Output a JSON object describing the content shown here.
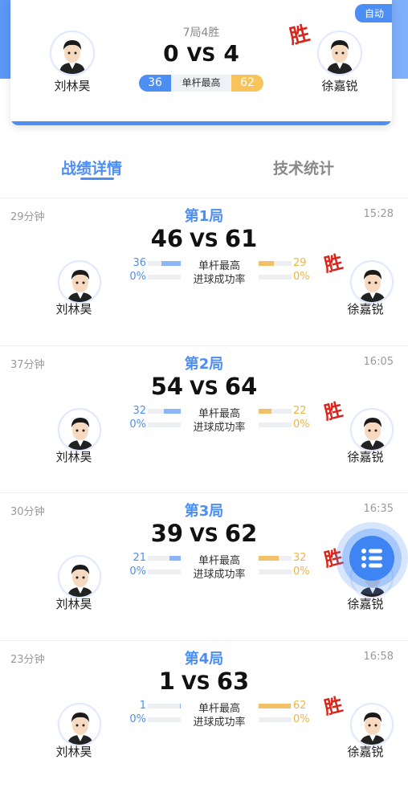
{
  "header": {
    "auto_label": "自动",
    "match_count": "7局4胜",
    "left_player": "刘林昊",
    "right_player": "徐嘉锐",
    "left_score": "0",
    "right_score": "4",
    "vs": "VS",
    "win_mark": "胜",
    "left_high_break": "36",
    "right_high_break": "62",
    "high_break_label": "单杆最高"
  },
  "tabs": {
    "active": "战绩详情",
    "inactive": "技术统计"
  },
  "labels": {
    "high_break": "单杆最高",
    "pot_rate": "进球成功率",
    "vs": "VS",
    "win": "胜"
  },
  "games": [
    {
      "duration": "29分钟",
      "time": "15:28",
      "title": "第1局",
      "left_score": "46",
      "right_score": "61",
      "left_break": "36",
      "right_break": "29",
      "left_rate": "0%",
      "right_rate": "0%",
      "left_player": "刘林昊",
      "right_player": "徐嘉锐",
      "left_break_fill": 0.58,
      "right_break_fill": 0.47,
      "winner": "right"
    },
    {
      "duration": "37分钟",
      "time": "16:05",
      "title": "第2局",
      "left_score": "54",
      "right_score": "64",
      "left_break": "32",
      "right_break": "22",
      "left_rate": "0%",
      "right_rate": "0%",
      "left_player": "刘林昊",
      "right_player": "徐嘉锐",
      "left_break_fill": 0.52,
      "right_break_fill": 0.4,
      "winner": "right"
    },
    {
      "duration": "30分钟",
      "time": "16:35",
      "title": "第3局",
      "left_score": "39",
      "right_score": "62",
      "left_break": "21",
      "right_break": "32",
      "left_rate": "0%",
      "right_rate": "0%",
      "left_player": "刘林昊",
      "right_player": "徐嘉锐",
      "left_break_fill": 0.35,
      "right_break_fill": 0.62,
      "winner": "right"
    },
    {
      "duration": "23分钟",
      "time": "16:58",
      "title": "第4局",
      "left_score": "1",
      "right_score": "63",
      "left_break": "1",
      "right_break": "62",
      "left_rate": "0%",
      "right_rate": "0%",
      "left_player": "刘林昊",
      "right_player": "徐嘉锐",
      "left_break_fill": 0.02,
      "right_break_fill": 0.98,
      "winner": "right"
    }
  ],
  "fab": {
    "icon": "list-icon"
  },
  "colors": {
    "accent": "#4d8ef5",
    "gold": "#f6c45a",
    "win_red": "#d9261c"
  }
}
